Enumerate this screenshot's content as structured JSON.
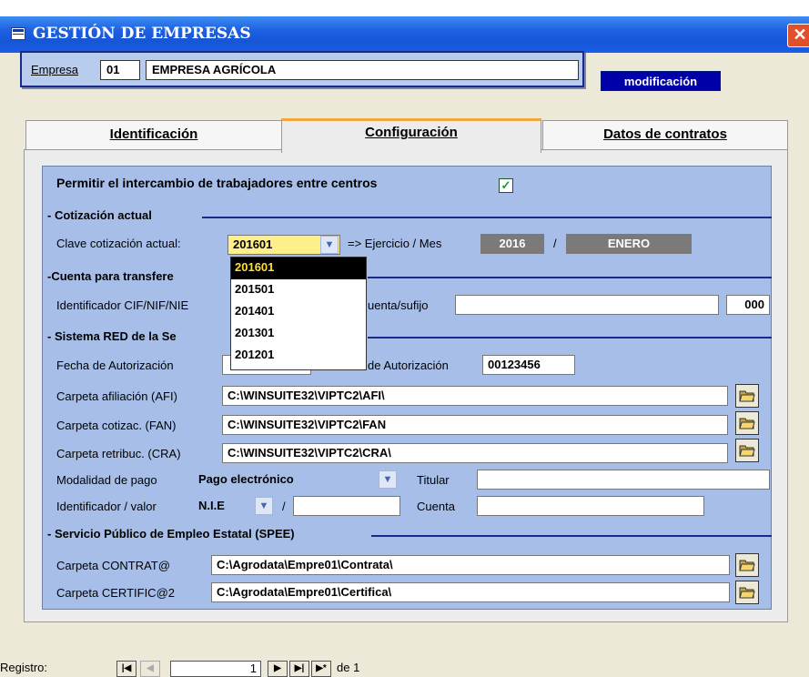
{
  "window": {
    "title": "GESTIÓN DE EMPRESAS",
    "close_glyph": "✕"
  },
  "empresa": {
    "label": "Empresa",
    "code": "01",
    "name": "EMPRESA AGRÍCOLA"
  },
  "mode_badge": "modificación",
  "tabs": [
    {
      "label": "Identificación",
      "active": false
    },
    {
      "label": "Configuración",
      "active": true
    },
    {
      "label": "Datos de contratos",
      "active": false
    }
  ],
  "config": {
    "intercambio_label": "Permitir el intercambio de trabajadores entre centros",
    "intercambio_checked": true,
    "section_cotizacion": "- Cotización actual",
    "clave_label": "Clave cotización actual:",
    "clave_value": "201601",
    "ejercicio_label": "=> Ejercicio / Mes",
    "ejercicio_year": "2016",
    "slash": "/",
    "ejercicio_month": "ENERO",
    "section_cuenta": "-Cuenta para transfere",
    "cif_label": "Identificador CIF/NIF/NIE",
    "cuenta_sufijo_label": "uenta/sufijo",
    "cuenta_sufijo_value": "",
    "sufijo_value": "000",
    "section_red": "- Sistema RED de la Se",
    "fecha_aut_label": "Fecha de Autorización",
    "num_aut_label": "de Autorización",
    "num_aut_value": "00123456",
    "afi_label": "Carpeta afiliación (AFI)",
    "afi_value": "C:\\WINSUITE32\\VIPTC2\\AFI\\",
    "fan_label": "Carpeta cotizac. (FAN)",
    "fan_value": "C:\\WINSUITE32\\VIPTC2\\FAN",
    "cra_label": "Carpeta retribuc. (CRA)",
    "cra_value": "C:\\WINSUITE32\\VIPTC2\\CRA\\",
    "modalidad_label": "Modalidad de pago",
    "modalidad_value": "Pago electrónico",
    "titular_label": "Titular",
    "titular_value": "",
    "identificador_label": "Identificador / valor",
    "identificador_value": "N.I.E",
    "identificador_sep": "/",
    "valor_value": "",
    "cuenta_label": "Cuenta",
    "cuenta_value": "",
    "section_spee": "- Servicio Público de Empleo Estatal (SPEE)",
    "contrat_label": "Carpeta CONTRAT@",
    "contrat_value": "C:\\Agrodata\\Empre01\\Contrata\\",
    "certific_label": "Carpeta CERTIFIC@2",
    "certific_value": "C:\\Agrodata\\Empre01\\Certifica\\"
  },
  "dropdown_options": [
    "201601",
    "201501",
    "201401",
    "201301",
    "201201"
  ],
  "navigation": {
    "label": "Registro:",
    "current": "1",
    "of_label": "de 1"
  },
  "icons": [
    "app-icon",
    "close-icon",
    "checkmark-icon",
    "chevron-down-icon",
    "folder-open-icon",
    "first-record-icon",
    "prev-record-icon",
    "next-record-icon",
    "last-record-icon",
    "new-record-icon"
  ]
}
